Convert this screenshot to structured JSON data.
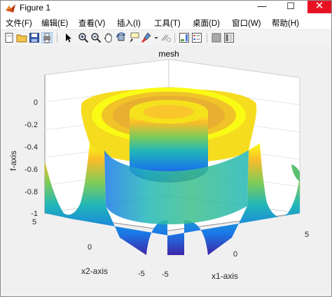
{
  "window": {
    "title": "Figure 1",
    "minimize_glyph": "—",
    "maximize_glyph": "☐",
    "close_glyph": "✕"
  },
  "menu": {
    "items": [
      {
        "label": "文件(F)"
      },
      {
        "label": "编辑(E)"
      },
      {
        "label": "查看(V)"
      },
      {
        "label": "插入(I)"
      },
      {
        "label": "工具(T)"
      },
      {
        "label": "桌面(D)"
      },
      {
        "label": "窗口(W)"
      },
      {
        "label": "帮助(H)"
      }
    ]
  },
  "toolbar": {
    "icons": [
      "new-figure-icon",
      "open-file-icon",
      "save-icon",
      "print-icon",
      "edit-plot-arrow-icon",
      "zoom-in-icon",
      "zoom-out-icon",
      "pan-hand-icon",
      "rotate-3d-icon",
      "data-cursor-icon",
      "brush-icon",
      "link-plot-icon",
      "insert-colorbar-icon",
      "insert-legend-icon",
      "hide-plot-tools-icon",
      "show-plot-tools-icon"
    ]
  },
  "colors": {
    "colormap": [
      "#3e26a8",
      "#1a7ae8",
      "#22b7b7",
      "#80cb58",
      "#f9bc2a",
      "#f9fb14"
    ]
  },
  "chart_data": {
    "type": "surface",
    "title": "mesh",
    "xlabel": "x1-axis",
    "ylabel": "x2-axis",
    "zlabel": "f-axis",
    "xlim": [
      -5,
      5
    ],
    "ylim": [
      -5,
      5
    ],
    "zlim": [
      -1,
      0
    ],
    "xticks": [
      -5,
      0,
      5
    ],
    "yticks": [
      -5,
      0,
      5
    ],
    "zticks": [
      0,
      -0.2,
      -0.4,
      -0.6,
      -0.8,
      -1
    ],
    "xtick_labels": [
      "-5",
      "0",
      "5"
    ],
    "ytick_labels": [
      "-5",
      "0",
      "5"
    ],
    "ztick_labels": [
      "0",
      "-0.2",
      "-0.4",
      "-0.6",
      "-0.8",
      "-1"
    ],
    "radial_profile": {
      "r": [
        0,
        1.0,
        1.2,
        1.5,
        2.0,
        2.6,
        3.0,
        3.4,
        3.8,
        4.2,
        4.7,
        5.2,
        5.8,
        6.4,
        7.07
      ],
      "f": [
        -0.05,
        -0.05,
        -0.2,
        -0.9,
        -1.0,
        -0.5,
        -0.05,
        -0.05,
        -0.2,
        -0.9,
        -1.0,
        -0.8,
        -0.4,
        -0.15,
        -0.05
      ]
    },
    "grid": true,
    "colormap": "parula"
  }
}
